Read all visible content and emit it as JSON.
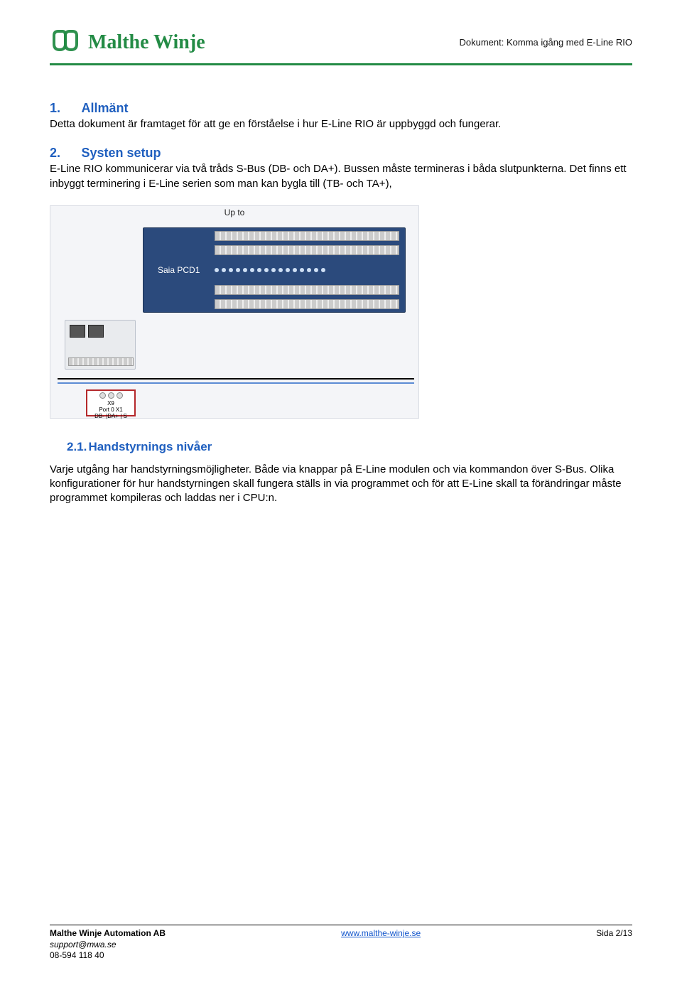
{
  "header": {
    "brand": "Malthe Winje",
    "doc_label": "Dokument: Komma igång med E-Line RIO"
  },
  "sections": {
    "s1": {
      "num": "1.",
      "title": "Allmänt",
      "body": "Detta dokument är framtaget för att ge en förståelse i hur E-Line RIO är uppbyggd och fungerar."
    },
    "s2": {
      "num": "2.",
      "title": "Systen setup",
      "body": "E-Line RIO kommunicerar via två tråds S-Bus (DB- och DA+). Bussen måste termineras i båda slutpunkterna. Det finns ett inbyggt terminering i E-Line serien som man kan bygla till (TB- och TA+),"
    },
    "diagram": {
      "upto": "Up to",
      "pcd_label": "Saia PCD1",
      "conn_x9": "X9",
      "conn_port": "Port 0    X1",
      "conn_pins": "DB-  |DA+  |  S"
    },
    "s21": {
      "num": "2.1.",
      "title": "Handstyrnings nivåer",
      "body": "Varje utgång har handstyrningsmöjligheter. Både via knappar på E-Line modulen och via kommandon över S-Bus. Olika konfigurationer för hur handstyrningen skall fungera ställs in via programmet och för att E-Line skall ta förändringar måste programmet kompileras och laddas ner i CPU:n."
    }
  },
  "footer": {
    "company": "Malthe Winje Automation AB",
    "email": "support@mwa.se",
    "phone": "08-594 118 40",
    "url": "www.malthe-winje.se",
    "page": "Sida 2/13"
  }
}
